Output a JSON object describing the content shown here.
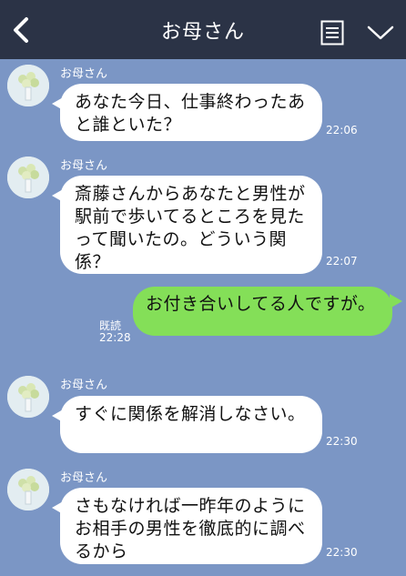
{
  "header": {
    "title": "お母さん",
    "back_icon": "chevron-left-icon",
    "menu_icon": "list-icon",
    "collapse_icon": "chevron-down-icon",
    "background": "#2b3346"
  },
  "colors": {
    "chat_background": "#7b96c5",
    "incoming_bubble": "#ffffff",
    "outgoing_bubble": "#84df58"
  },
  "messages": [
    {
      "direction": "in",
      "sender": "お母さん",
      "text": "あなた今日、仕事終わったあと誰といた？",
      "time": "22:06"
    },
    {
      "direction": "in",
      "sender": "お母さん",
      "text": "斎藤さんからあなたと男性が駅前で歩いてるところを見たって聞いたの。どういう関係？",
      "time": "22:07"
    },
    {
      "direction": "out",
      "text": "お付き合いしてる人ですが。",
      "read_label": "既読",
      "time": "22:28"
    },
    {
      "direction": "in",
      "sender": "お母さん",
      "text": "すぐに関係を解消しなさい。",
      "time": "22:30"
    },
    {
      "direction": "in",
      "sender": "お母さん",
      "text": "さもなければ一昨年のようにお相手の男性を徹底的に調べるから",
      "time": "22:30"
    }
  ]
}
